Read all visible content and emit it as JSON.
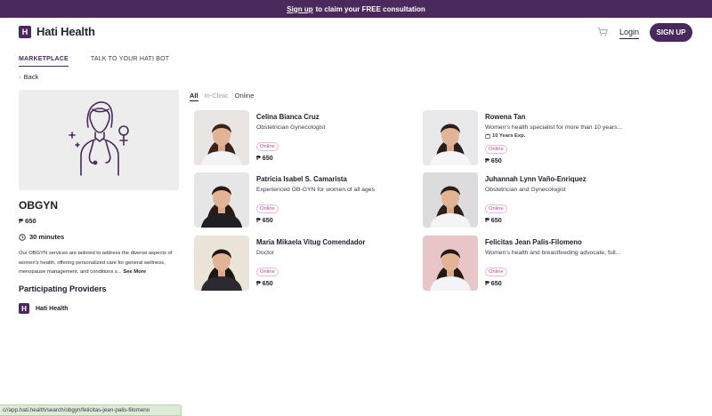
{
  "banner": {
    "link_text": "Sign up",
    "rest_text": "to claim your FREE consultation"
  },
  "header": {
    "logo_mark": "H",
    "logo_text": "Hati Health",
    "login_label": "Login",
    "signup_label": "SIGN UP",
    "cart_icon": "cart-icon"
  },
  "nav": {
    "tabs": [
      {
        "label": "MARKETPLACE",
        "active": true
      },
      {
        "label": "TALK TO YOUR HATI BOT",
        "active": false
      }
    ]
  },
  "back_label": "Back",
  "service": {
    "title": "OBGYN",
    "price": "₱ 650",
    "duration": "30 minutes",
    "description": "Our OBGYN services are tailored to address the diverse aspects of women's health, offering personalized care for general wellness, menopause management, and conditions s...",
    "see_more": "See More",
    "providers_heading": "Participating Providers",
    "provider_name": "Hati Health",
    "provider_mark": "H"
  },
  "filters": [
    {
      "label": "All",
      "state": "active"
    },
    {
      "label": "In-Clinic",
      "state": "muted"
    },
    {
      "label": "Online",
      "state": "normal"
    }
  ],
  "doctors": [
    {
      "name": "Celina Bianca Cruz",
      "title": "Obstetrician Gynecologist",
      "experience": "",
      "badge": "Online",
      "price": "₱ 650",
      "bg": "#e9e5e2",
      "hair": "#3a2418",
      "top": "#f4f4f6"
    },
    {
      "name": "Rowena Tan",
      "title": "Women's health specialist for more than 10 years...",
      "experience": "10 Years Exp.",
      "badge": "Online",
      "price": "₱ 650",
      "bg": "#e8e8ea",
      "hair": "#2a1e1a",
      "top": "#f6f6f8"
    },
    {
      "name": "Patricia Isabel S. Camarista",
      "title": "Experienced OB-GYN for women of all ages",
      "experience": "",
      "badge": "Online",
      "price": "₱ 650",
      "bg": "#e6e6e8",
      "hair": "#2a1812",
      "top": "#1f1f24"
    },
    {
      "name": "Juhannah Lynn Vaño-Enriquez",
      "title": "Obstetrician and Gynecologist",
      "experience": "",
      "badge": "Online",
      "price": "₱ 650",
      "bg": "#dcdcde",
      "hair": "#2e1f18",
      "top": "#f4f4f6"
    },
    {
      "name": "Maria Mikaela Vitug Comendador",
      "title": "Doctor",
      "experience": "",
      "badge": "Online",
      "price": "₱ 650",
      "bg": "#ebe4d8",
      "hair": "#1e1410",
      "top": "#2a2a30"
    },
    {
      "name": "Felicitas Jean Palis-Filomeno",
      "title": "Women's health and breastfeeding advocate, full...",
      "experience": "",
      "badge": "Online",
      "price": "₱ 650",
      "bg": "#e8c6c8",
      "hair": "#241812",
      "top": "#f4f4f6"
    }
  ],
  "status_url": "c//app.hati.health/search/obgyn/felicitas-jean-palis-filomeno",
  "colors": {
    "brand": "#4a2a5c",
    "badge": "#b24a9c"
  }
}
